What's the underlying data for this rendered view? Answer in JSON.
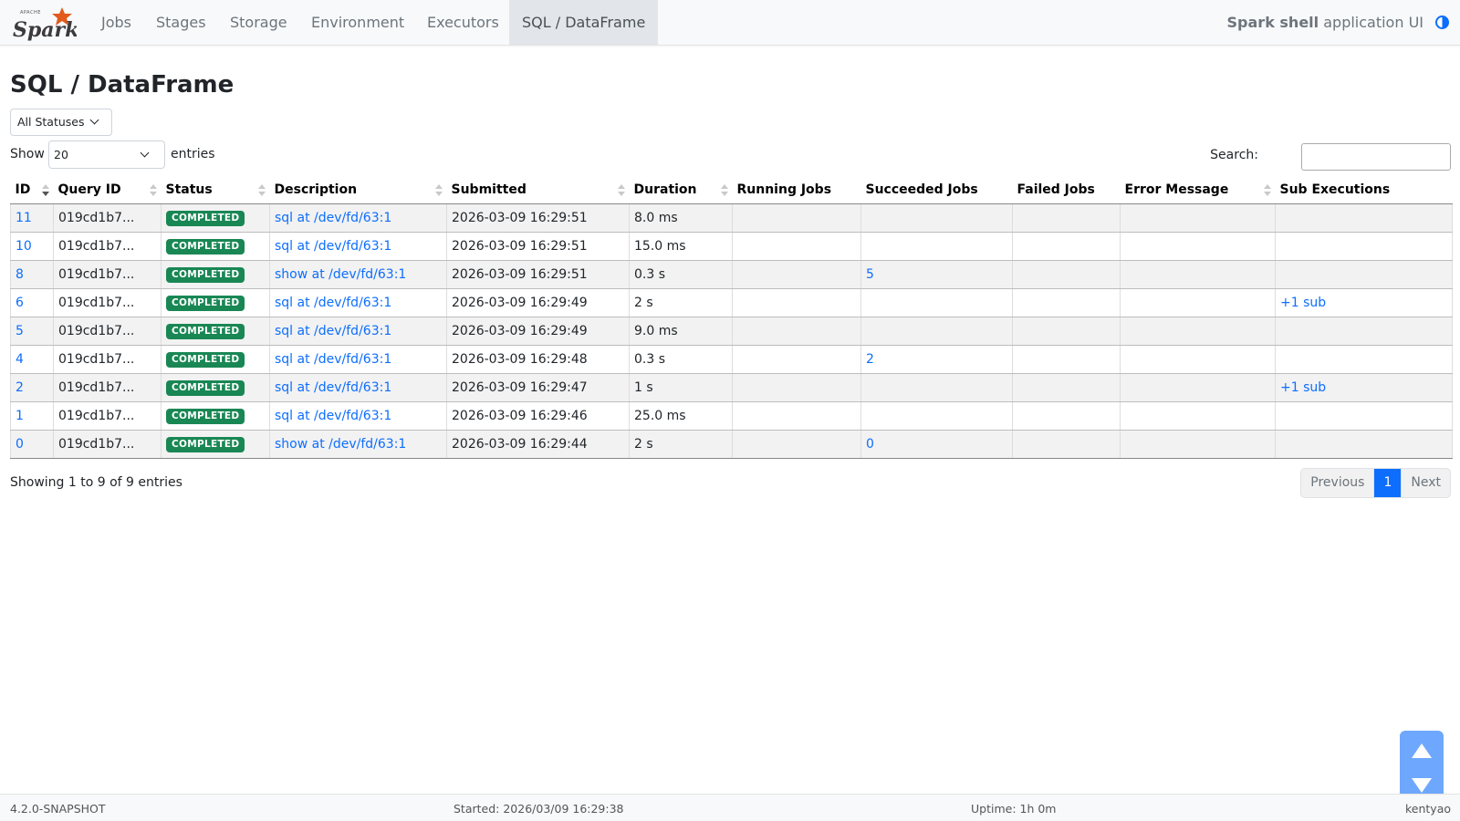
{
  "nav": {
    "brand_sub": "APACHE",
    "brand": "Spark",
    "tabs": [
      {
        "label": "Jobs"
      },
      {
        "label": "Stages"
      },
      {
        "label": "Storage"
      },
      {
        "label": "Environment"
      },
      {
        "label": "Executors"
      },
      {
        "label": "SQL / DataFrame"
      }
    ],
    "active_tab": "SQL / DataFrame",
    "app_name": "Spark shell",
    "app_suffix": " application UI"
  },
  "page": {
    "title": "SQL / DataFrame",
    "status_filter": "All Statuses",
    "show_label": "Show",
    "page_size": "20",
    "entries_label": "entries",
    "search_label": "Search:",
    "search_value": ""
  },
  "table": {
    "columns": [
      "ID",
      "Query ID",
      "Status",
      "Description",
      "Submitted",
      "Duration",
      "Running Jobs",
      "Succeeded Jobs",
      "Failed Jobs",
      "Error Message",
      "Sub Executions"
    ],
    "rows": [
      {
        "id": "11",
        "query_id": "019cd1b7...",
        "status": "COMPLETED",
        "description": "sql at /dev/fd/63:1",
        "submitted": "2026-03-09 16:29:51",
        "duration": "8.0 ms",
        "running": "",
        "succeeded": "",
        "failed": "",
        "error": "",
        "sub": ""
      },
      {
        "id": "10",
        "query_id": "019cd1b7...",
        "status": "COMPLETED",
        "description": "sql at /dev/fd/63:1",
        "submitted": "2026-03-09 16:29:51",
        "duration": "15.0 ms",
        "running": "",
        "succeeded": "",
        "failed": "",
        "error": "",
        "sub": ""
      },
      {
        "id": "8",
        "query_id": "019cd1b7...",
        "status": "COMPLETED",
        "description": "show at /dev/fd/63:1",
        "submitted": "2026-03-09 16:29:51",
        "duration": "0.3 s",
        "running": "",
        "succeeded": "5",
        "failed": "",
        "error": "",
        "sub": ""
      },
      {
        "id": "6",
        "query_id": "019cd1b7...",
        "status": "COMPLETED",
        "description": "sql at /dev/fd/63:1",
        "submitted": "2026-03-09 16:29:49",
        "duration": "2 s",
        "running": "",
        "succeeded": "",
        "failed": "",
        "error": "",
        "sub": "+1 sub"
      },
      {
        "id": "5",
        "query_id": "019cd1b7...",
        "status": "COMPLETED",
        "description": "sql at /dev/fd/63:1",
        "submitted": "2026-03-09 16:29:49",
        "duration": "9.0 ms",
        "running": "",
        "succeeded": "",
        "failed": "",
        "error": "",
        "sub": ""
      },
      {
        "id": "4",
        "query_id": "019cd1b7...",
        "status": "COMPLETED",
        "description": "sql at /dev/fd/63:1",
        "submitted": "2026-03-09 16:29:48",
        "duration": "0.3 s",
        "running": "",
        "succeeded": "2",
        "failed": "",
        "error": "",
        "sub": ""
      },
      {
        "id": "2",
        "query_id": "019cd1b7...",
        "status": "COMPLETED",
        "description": "sql at /dev/fd/63:1",
        "submitted": "2026-03-09 16:29:47",
        "duration": "1 s",
        "running": "",
        "succeeded": "",
        "failed": "",
        "error": "",
        "sub": "+1 sub"
      },
      {
        "id": "1",
        "query_id": "019cd1b7...",
        "status": "COMPLETED",
        "description": "sql at /dev/fd/63:1",
        "submitted": "2026-03-09 16:29:46",
        "duration": "25.0 ms",
        "running": "",
        "succeeded": "",
        "failed": "",
        "error": "",
        "sub": ""
      },
      {
        "id": "0",
        "query_id": "019cd1b7...",
        "status": "COMPLETED",
        "description": "show at /dev/fd/63:1",
        "submitted": "2026-03-09 16:29:44",
        "duration": "2 s",
        "running": "",
        "succeeded": "0",
        "failed": "",
        "error": "",
        "sub": ""
      }
    ]
  },
  "info": "Showing 1 to 9 of 9 entries",
  "pagination": {
    "prev": "Previous",
    "current": "1",
    "next": "Next"
  },
  "footer": {
    "version": "4.2.0-SNAPSHOT",
    "started": "Started: 2026/03/09 16:29:38",
    "uptime": "Uptime: 1h 0m",
    "user": "kentyao"
  },
  "colors": {
    "link": "#0d6efd",
    "status_completed": "#198754",
    "active_page": "#0d6efd"
  }
}
